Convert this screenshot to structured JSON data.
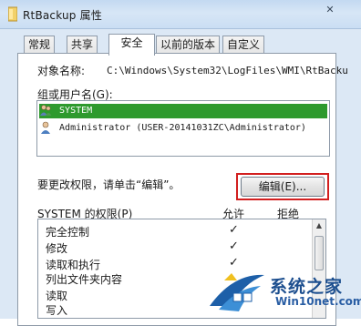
{
  "window": {
    "title": "RtBackup 属性",
    "close_glyph": "✕"
  },
  "tabs": [
    {
      "label": "常规"
    },
    {
      "label": "共享"
    },
    {
      "label": "安全"
    },
    {
      "label": "以前的版本"
    },
    {
      "label": "自定义"
    }
  ],
  "object": {
    "label": "对象名称:",
    "value": "C:\\Windows\\System32\\LogFiles\\WMI\\RtBacku"
  },
  "users": {
    "label": "组或用户名(G):",
    "items": [
      {
        "name": "SYSTEM",
        "selected": true,
        "icon": "users-group-icon"
      },
      {
        "name": "Administrator (USER-20141031ZC\\Administrator)",
        "selected": false,
        "icon": "user-icon"
      }
    ]
  },
  "change_hint": "要更改权限，请单击“编辑”。",
  "edit_button": "编辑(E)...",
  "permissions": {
    "header": "SYSTEM 的权限(P)",
    "allow_header": "允许",
    "deny_header": "拒绝",
    "rows": [
      {
        "name": "完全控制",
        "allow": "✓"
      },
      {
        "name": "修改",
        "allow": "✓"
      },
      {
        "name": "读取和执行",
        "allow": "✓"
      },
      {
        "name": "列出文件夹内容",
        "allow": ""
      },
      {
        "name": "读取",
        "allow": ""
      },
      {
        "name": "写入",
        "allow": ""
      }
    ]
  },
  "watermark": {
    "cn": "系统之家",
    "en": "Win10net.com"
  },
  "colors": {
    "selection": "#2e9a2e",
    "highlight_box": "#d21f1f",
    "window_frame": "#dce8f5"
  }
}
